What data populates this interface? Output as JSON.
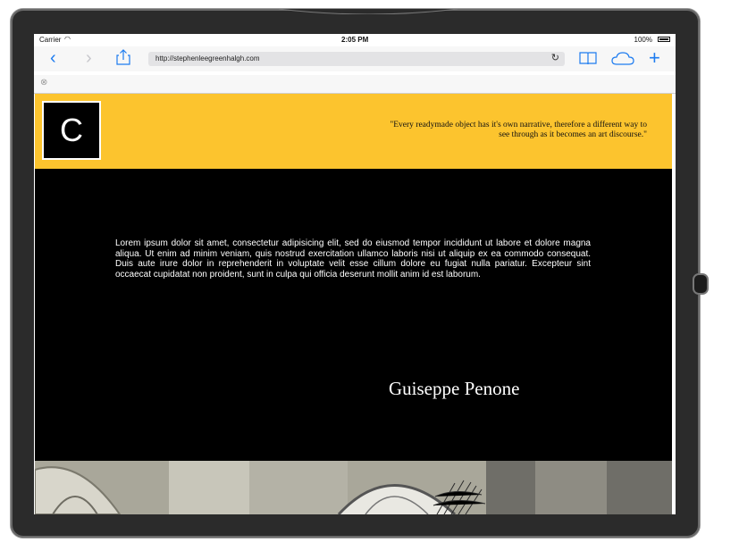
{
  "status": {
    "carrier": "Carrier",
    "time": "2:05 PM",
    "battery": "100%"
  },
  "browser": {
    "url": "http://stephenleegreenhalgh.com",
    "back": "‹",
    "forward": "›",
    "reload": "↻",
    "add": "+"
  },
  "header": {
    "logo_letter": "C",
    "quote": "\"Every readymade object has it's own narrative, therefore a different way to see through as it becomes an art discourse.\""
  },
  "main": {
    "body_text": "Lorem ipsum dolor sit amet, consectetur adipisicing elit, sed do eiusmod tempor incididunt ut labore et dolore magna aliqua. Ut enim ad minim veniam, quis nostrud exercitation ullamco laboris nisi ut aliquip ex ea commodo consequat. Duis aute irure dolor in reprehenderit in voluptate velit esse cillum dolore eu fugiat nulla pariatur. Excepteur sint occaecat cupidatat non proident, sunt in culpa qui officia deserunt mollit anim id est laborum.",
    "artist_name": "Guiseppe Penone"
  },
  "colors": {
    "header_bg": "#fcc42e",
    "page_bg": "#000000",
    "accent": "#1e7cf0"
  },
  "icons": [
    "share-icon",
    "bookmarks-icon",
    "cloud-icon",
    "close-icon",
    "wifi-icon"
  ]
}
